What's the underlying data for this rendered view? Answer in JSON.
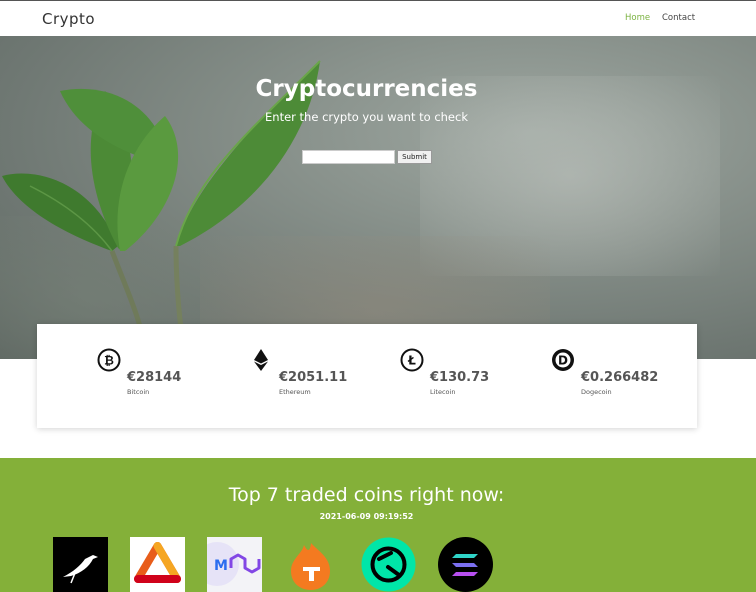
{
  "nav": {
    "brand": "Crypto",
    "links": [
      {
        "label": "Home",
        "active": true
      },
      {
        "label": "Contact",
        "active": false
      }
    ]
  },
  "hero": {
    "title": "Cryptocurrencies",
    "subtitle": "Enter the crypto you want to check",
    "search": {
      "value": "",
      "placeholder": ""
    },
    "submit_label": "Submit"
  },
  "prices": [
    {
      "price": "€28144",
      "name": "Bitcoin",
      "icon": "bitcoin-icon"
    },
    {
      "price": "€2051.11",
      "name": "Ethereum",
      "icon": "ethereum-icon"
    },
    {
      "price": "€130.73",
      "name": "Litecoin",
      "icon": "litecoin-icon"
    },
    {
      "price": "€0.266482",
      "name": "Dogecoin",
      "icon": "dogecoin-icon"
    }
  ],
  "top_traded": {
    "title": "Top 7 traded coins right now:",
    "timestamp": "2021-06-09 09:19:52",
    "coins": [
      {
        "icon": "raven-bird-icon"
      },
      {
        "icon": "orange-triangle-icon"
      },
      {
        "icon": "polygon-icon"
      },
      {
        "icon": "flame-icon"
      },
      {
        "icon": "teal-coin-icon"
      },
      {
        "icon": "solana-icon"
      }
    ]
  },
  "colors": {
    "accent": "#7cb342",
    "section_green": "#84b039"
  }
}
